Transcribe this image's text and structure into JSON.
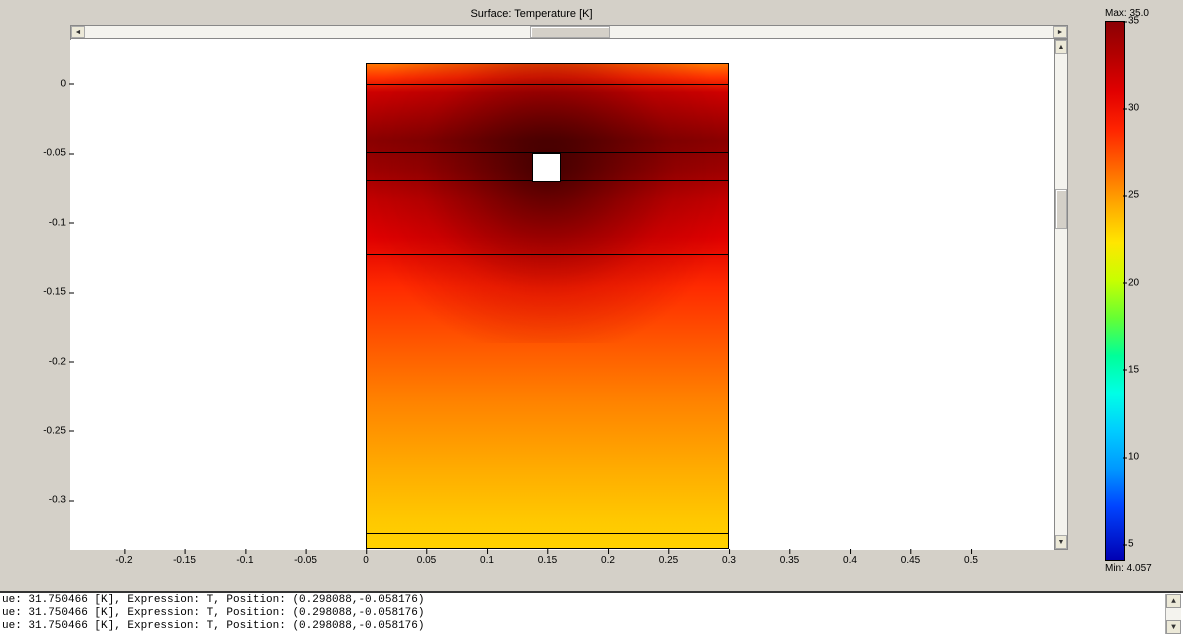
{
  "title": "Surface: Temperature [K]",
  "xaxis": {
    "ticks": [
      {
        "value": "-0.2",
        "pos": 124
      },
      {
        "value": "-0.15",
        "pos": 186
      },
      {
        "value": "-0.1",
        "pos": 248
      },
      {
        "value": "-0.05",
        "pos": 310
      },
      {
        "value": "0",
        "pos": 372
      },
      {
        "value": "0.05",
        "pos": 434
      },
      {
        "value": "0.1",
        "pos": 496
      },
      {
        "value": "0.15",
        "pos": 558
      },
      {
        "value": "0.2",
        "pos": 620
      },
      {
        "value": "0.25",
        "pos": 682
      },
      {
        "value": "0.3",
        "pos": 744
      },
      {
        "value": "0.35",
        "pos": 806
      },
      {
        "value": "0.4",
        "pos": 868
      },
      {
        "value": "0.45",
        "pos": 930
      },
      {
        "value": "0.5",
        "pos": 992
      }
    ]
  },
  "yaxis": {
    "ticks": [
      {
        "value": "0",
        "pos": 81
      },
      {
        "value": "-0.05",
        "pos": 152
      },
      {
        "value": "-0.1",
        "pos": 223
      },
      {
        "value": "-0.15",
        "pos": 294
      },
      {
        "value": "-0.2",
        "pos": 365
      },
      {
        "value": "-0.25",
        "pos": 436
      },
      {
        "value": "-0.3",
        "pos": 507
      }
    ]
  },
  "colorbar": {
    "max_label": "Max: 35.0",
    "min_label": "Min: 4.057",
    "ticks": [
      {
        "value": "35",
        "pct": 0
      },
      {
        "value": "30",
        "pct": 16.2
      },
      {
        "value": "25",
        "pct": 32.3
      },
      {
        "value": "20",
        "pct": 48.5
      },
      {
        "value": "15",
        "pct": 64.6
      },
      {
        "value": "10",
        "pct": 80.8
      },
      {
        "value": "5",
        "pct": 96.9
      }
    ]
  },
  "chart_data": {
    "type": "heatmap",
    "title": "Surface: Temperature [K]",
    "xlabel": "",
    "ylabel": "",
    "xlim": [
      -0.24,
      0.55
    ],
    "ylim": [
      -0.335,
      0.015
    ],
    "colormap": "jet",
    "cmin": 4.057,
    "cmax": 35.0,
    "domain_rect": {
      "x0": 0.0,
      "x1": 0.3,
      "y0": -0.335,
      "y1": 0.015
    },
    "cutout_rect": {
      "x0": 0.138,
      "x1": 0.162,
      "y0": -0.072,
      "y1": -0.048
    },
    "internal_boundaries_y": [
      0.0,
      -0.048,
      -0.068,
      -0.12,
      -0.318
    ],
    "probe_points": [
      {
        "x": 0.298088,
        "y": -0.058176,
        "value": 31.750466,
        "expression": "T",
        "units": "K"
      }
    ],
    "description": "Temperature distribution on a rectangular surface (0<=x<=0.3, -0.335<=y<=0.015) with a small square cutout near (0.15,-0.06). Highest temperatures (~35 K, dark red) surround the cutout, decreasing toward orange/yellow (~25 K) at the top edge and orange-yellow (~22 K) at the bottom. Minimum of 4.057 K corresponds to the coolest region per colorbar."
  },
  "log": {
    "lines": [
      "ue: 31.750466 [K], Expression: T, Position: (0.298088,-0.058176)",
      "ue: 31.750466 [K], Expression: T, Position: (0.298088,-0.058176)",
      "ue: 31.750466 [K], Expression: T, Position: (0.298088,-0.058176)"
    ]
  }
}
